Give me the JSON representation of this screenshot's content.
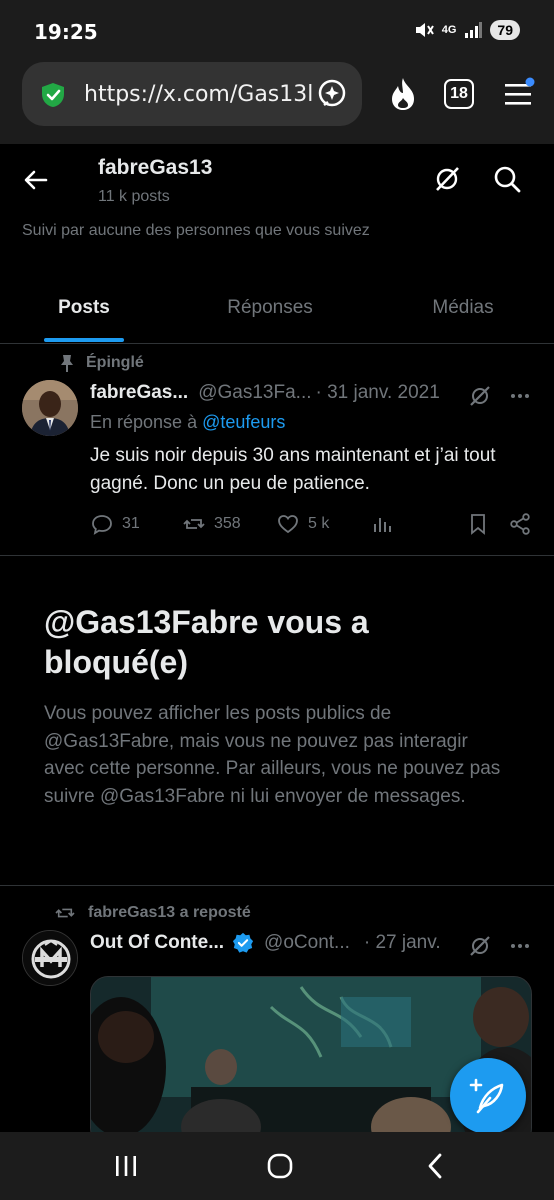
{
  "status_bar": {
    "time": "19:25",
    "network": "4G",
    "battery": "79"
  },
  "browser": {
    "url": "https://x.com/Gas13l",
    "tab_count": "18",
    "icons": [
      "shield-check-icon",
      "assistant-sparkle-icon",
      "fire-icon",
      "tabs-icon",
      "menu-icon"
    ]
  },
  "profile": {
    "name": "fabreGas13",
    "post_count": "11 k posts",
    "followed_by": "Suivi par aucune des personnes que vous suivez"
  },
  "tabs": [
    {
      "label": "Posts",
      "active": true
    },
    {
      "label": "Réponses",
      "active": false
    },
    {
      "label": "Médias",
      "active": false
    }
  ],
  "pinned_tweet": {
    "pinned_label": "Épinglé",
    "author_name": "fabreGas...",
    "author_handle": "@Gas13Fa...",
    "date": "· 31 janv. 2021",
    "reply_prefix": "En réponse à",
    "reply_to": "@teufeurs",
    "text": "Je suis noir depuis 30 ans maintenant et j’ai tout gagné. Donc un peu de patience.",
    "replies": "31",
    "reposts": "358",
    "likes": "5 k"
  },
  "blocked_notice": {
    "title": "@Gas13Fabre vous a bloqué(e)",
    "description": "Vous pouvez afficher les posts publics de @Gas13Fabre, mais vous ne pouvez pas interagir avec cette personne. Par ailleurs, vous ne pouvez pas suivre @Gas13Fabre ni lui envoyer de messages."
  },
  "reposted_tweet": {
    "repost_label": "fabreGas13 a reposté",
    "author_name": "Out Of Conte...",
    "author_handle": "@oCont...",
    "date": "· 27 janv."
  },
  "colors": {
    "accent": "#1d9bf0",
    "muted_text": "#71767b",
    "primary_text": "#e7e9ea",
    "background": "#000000",
    "divider": "#2f3336"
  }
}
